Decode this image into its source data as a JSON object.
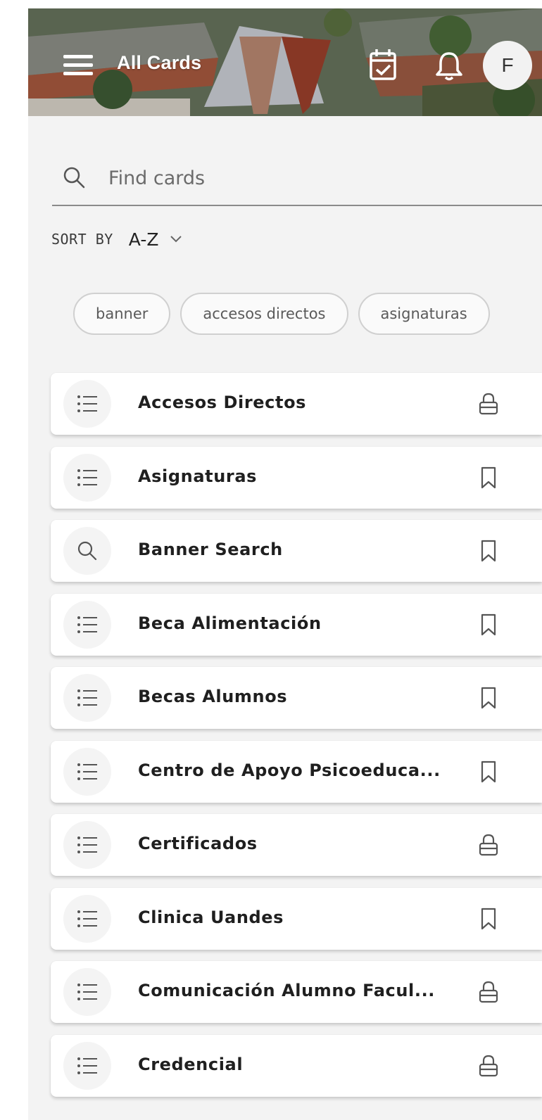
{
  "header": {
    "title": "All Cards",
    "avatar_initial": "F",
    "icons": [
      "menu-icon",
      "calendar-check-icon",
      "bell-icon"
    ]
  },
  "search": {
    "placeholder": "Find cards",
    "value": ""
  },
  "sort": {
    "label": "SORT BY",
    "value": "A-Z"
  },
  "chips": [
    "banner",
    "accesos directos",
    "asignaturas"
  ],
  "cards": [
    {
      "title": "Accesos Directos",
      "icon": "list-icon",
      "action": "lock-icon"
    },
    {
      "title": "Asignaturas",
      "icon": "list-icon",
      "action": "bookmark-icon"
    },
    {
      "title": "Banner Search",
      "icon": "search-icon",
      "action": "bookmark-icon"
    },
    {
      "title": "Beca Alimentación",
      "icon": "list-icon",
      "action": "bookmark-icon"
    },
    {
      "title": "Becas Alumnos",
      "icon": "list-icon",
      "action": "bookmark-icon"
    },
    {
      "title": "Centro de Apoyo Psicoeduca...",
      "icon": "list-icon",
      "action": "bookmark-icon"
    },
    {
      "title": "Certificados",
      "icon": "list-icon",
      "action": "lock-icon"
    },
    {
      "title": "Clinica Uandes",
      "icon": "list-icon",
      "action": "bookmark-icon"
    },
    {
      "title": "Comunicación Alumno Facul...",
      "icon": "list-icon",
      "action": "lock-icon"
    },
    {
      "title": "Credencial",
      "icon": "list-icon",
      "action": "lock-icon"
    }
  ],
  "colors": {
    "background": "#f3f3f3",
    "card": "#ffffff",
    "text": "#1f1f1f",
    "icon": "#555555"
  }
}
